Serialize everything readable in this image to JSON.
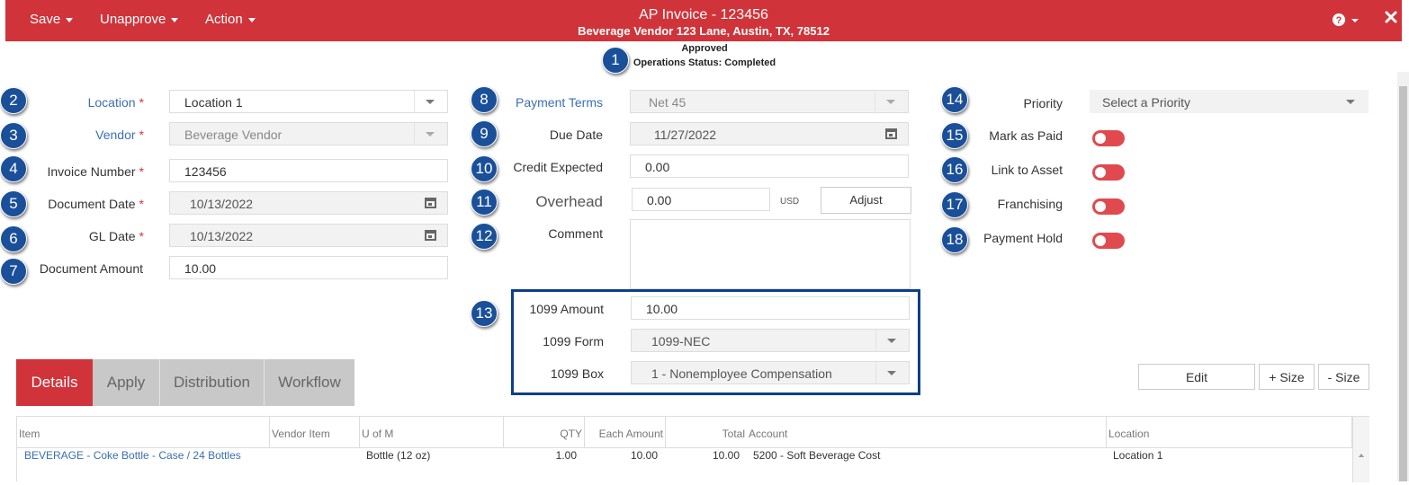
{
  "header": {
    "menus": [
      "Save",
      "Unapprove",
      "Action"
    ],
    "title": "AP Invoice - 123456",
    "subtitle": "Beverage Vendor 123 Lane, Austin, TX, 78512",
    "help_icon": "question-circle-icon",
    "close_icon": "close-icon"
  },
  "status": {
    "line1": "Approved",
    "line2": "Operations Status: Completed"
  },
  "badges": [
    "1",
    "2",
    "3",
    "4",
    "5",
    "6",
    "7",
    "8",
    "9",
    "10",
    "11",
    "12",
    "13",
    "14",
    "15",
    "16",
    "17",
    "18"
  ],
  "left": {
    "location": {
      "label": "Location",
      "value": "Location 1"
    },
    "vendor": {
      "label": "Vendor",
      "value": "Beverage Vendor"
    },
    "invoice_number": {
      "label": "Invoice Number",
      "value": "123456"
    },
    "document_date": {
      "label": "Document Date",
      "value": "10/13/2022"
    },
    "gl_date": {
      "label": "GL Date",
      "value": "10/13/2022"
    },
    "document_amount": {
      "label": "Document Amount",
      "value": "10.00"
    },
    "required_mark": "*"
  },
  "middle": {
    "payment_terms": {
      "label": "Payment Terms",
      "value": "Net 45"
    },
    "due_date": {
      "label": "Due Date",
      "value": "11/27/2022"
    },
    "credit_expected": {
      "label": "Credit Expected",
      "value": "0.00"
    },
    "overhead": {
      "label": "Overhead",
      "value": "0.00",
      "currency": "USD",
      "adjust": "Adjust"
    },
    "comment": {
      "label": "Comment",
      "value": ""
    },
    "ten99_amount": {
      "label": "1099 Amount",
      "value": "10.00"
    },
    "ten99_form": {
      "label": "1099 Form",
      "value": "1099-NEC"
    },
    "ten99_box": {
      "label": "1099 Box",
      "value": "1 - Nonemployee Compensation"
    }
  },
  "right": {
    "priority": {
      "label": "Priority",
      "placeholder": "Select a Priority"
    },
    "mark_as_paid": {
      "label": "Mark as Paid",
      "on": false
    },
    "link_to_asset": {
      "label": "Link to Asset",
      "on": false
    },
    "franchising": {
      "label": "Franchising",
      "on": false
    },
    "payment_hold": {
      "label": "Payment Hold",
      "on": false
    }
  },
  "tabs": [
    "Details",
    "Apply",
    "Distribution",
    "Workflow"
  ],
  "actions": {
    "edit": "Edit",
    "plus_size": "+ Size",
    "minus_size": "- Size"
  },
  "grid": {
    "columns": [
      "Item",
      "Vendor Item",
      "U of M",
      "QTY",
      "Each Amount",
      "Total",
      "Account",
      "Location"
    ],
    "rows": [
      [
        "BEVERAGE - Coke Bottle - Case / 24 Bottles",
        "",
        "Bottle (12 oz)",
        "1.00",
        "10.00",
        "10.00",
        "5200 - Soft Beverage Cost",
        "Location 1"
      ]
    ]
  },
  "colors": {
    "brand": "#d0343a",
    "badge": "#1a4f9a",
    "highlight_box": "#0d3f8a",
    "link": "#3a6fb3"
  }
}
